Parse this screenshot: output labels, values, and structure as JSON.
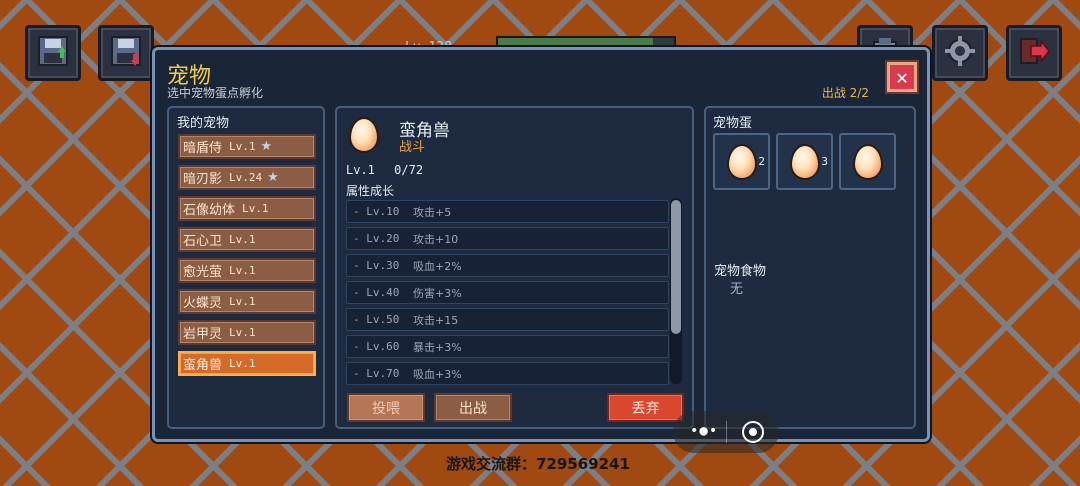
{
  "hud": {
    "level_text": "Lv.128",
    "bar_text": "",
    "buttons": [
      {
        "name": "save-upload-icon"
      },
      {
        "name": "save-download-icon"
      },
      {
        "name": "inventory-icon"
      },
      {
        "name": "settings-gear-icon"
      },
      {
        "name": "exit-door-icon"
      }
    ]
  },
  "dialog": {
    "title": "宠物",
    "subtitle": "选中宠物蛋点孵化",
    "deploy_count": "出战 2/2",
    "close_label": "✕"
  },
  "my_pets": {
    "title": "我的宠物",
    "items": [
      {
        "name": "暗盾侍",
        "level": "Lv.1",
        "starred": true
      },
      {
        "name": "暗刃影",
        "level": "Lv.24",
        "starred": true
      },
      {
        "name": "石像幼体",
        "level": "Lv.1",
        "starred": false
      },
      {
        "name": "石心卫",
        "level": "Lv.1",
        "starred": false
      },
      {
        "name": "愈光萤",
        "level": "Lv.1",
        "starred": false
      },
      {
        "name": "火蝶灵",
        "level": "Lv.1",
        "starred": false
      },
      {
        "name": "岩甲灵",
        "level": "Lv.1",
        "starred": false
      },
      {
        "name": "蛮角兽",
        "level": "Lv.1",
        "starred": false,
        "selected": true
      }
    ]
  },
  "pet_detail": {
    "name": "蛮角兽",
    "type": "战斗",
    "level": "Lv.1",
    "exp": "0/72",
    "growth_title": "属性成长",
    "growth": [
      {
        "level": "- Lv.10",
        "effect": "攻击+5"
      },
      {
        "level": "- Lv.20",
        "effect": "攻击+10"
      },
      {
        "level": "- Lv.30",
        "effect": "吸血+2%"
      },
      {
        "level": "- Lv.40",
        "effect": "伤害+3%"
      },
      {
        "level": "- Lv.50",
        "effect": "攻击+15"
      },
      {
        "level": "- Lv.60",
        "effect": "暴击+3%"
      },
      {
        "level": "- Lv.70",
        "effect": "吸血+3%"
      }
    ],
    "scroll_fraction": 0.72,
    "buttons": {
      "feed": "投喂",
      "deploy": "出战",
      "discard": "丢弃"
    }
  },
  "eggs": {
    "title": "宠物蛋",
    "slots": [
      {
        "count": "2"
      },
      {
        "count": "3"
      },
      {
        "count": ""
      }
    ]
  },
  "food": {
    "title": "宠物食物",
    "value": "无"
  },
  "mini_program": {
    "more_label": "•●•"
  },
  "footer": {
    "text": "游戏交流群：729569241"
  },
  "colors": {
    "accent_gold": "#f2cd4b",
    "selected_orange": "#d56a2a",
    "discard_red": "#d8472e",
    "panel_border": "#45607f"
  }
}
